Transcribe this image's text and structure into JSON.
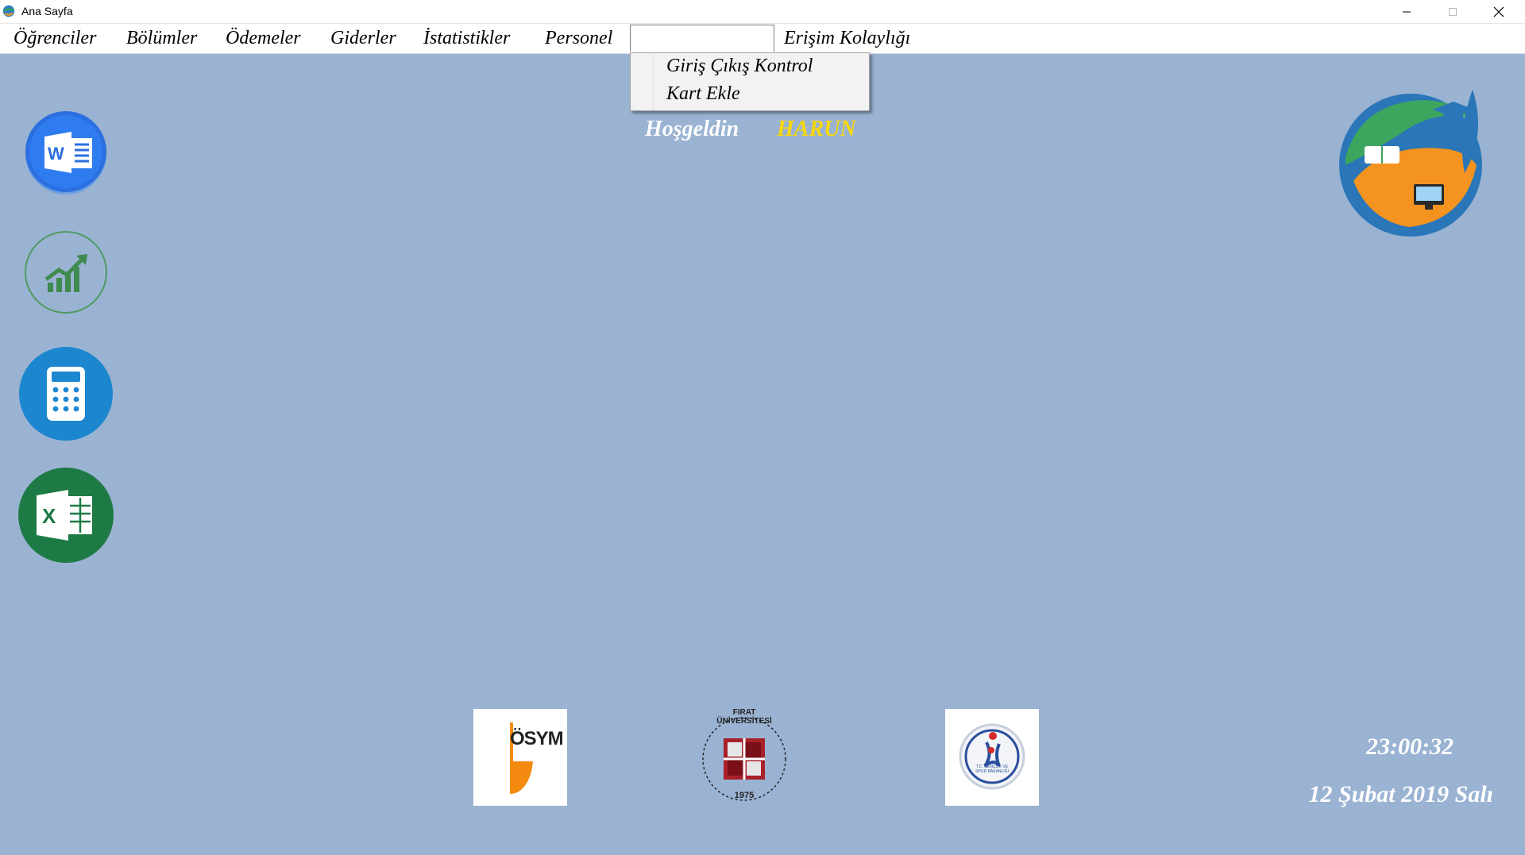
{
  "window": {
    "title": "Ana Sayfa",
    "controls": [
      "minimize-icon",
      "maximize-icon",
      "close-icon"
    ]
  },
  "menu": {
    "items": [
      {
        "label": "Öğrenciler"
      },
      {
        "label": "Bölümler"
      },
      {
        "label": "Ödemeler"
      },
      {
        "label": "Giderler"
      },
      {
        "label": "İstatistikler"
      },
      {
        "label": "Personel"
      },
      {
        "label": ""
      },
      {
        "label": "Erişim Kolaylığı"
      }
    ],
    "open_dropdown": {
      "items": [
        {
          "label": "Giriş Çıkış Kontrol"
        },
        {
          "label": "Kart Ekle"
        }
      ]
    }
  },
  "welcome": {
    "greeting": "Hoşgeldin",
    "username": "HARUN"
  },
  "sidebar": {
    "icons": [
      "word-icon",
      "statistics-icon",
      "calculator-icon",
      "excel-icon"
    ]
  },
  "logos": {
    "osym_text": "ÖSYM",
    "firat_text": "FIRAT ÜNİVERSİTESİ",
    "firat_year": "1975",
    "ministry_text": "T.C. GENÇLİK VE SPOR BAKANLIĞI"
  },
  "clock": {
    "time": "23:00:32",
    "date": "12 Şubat 2019 Salı"
  },
  "colors": {
    "background": "#9ab3d2",
    "username": "#f7d70a",
    "word": "#2b6fe0",
    "excel": "#1e7a45",
    "calculator": "#1c86cf"
  }
}
